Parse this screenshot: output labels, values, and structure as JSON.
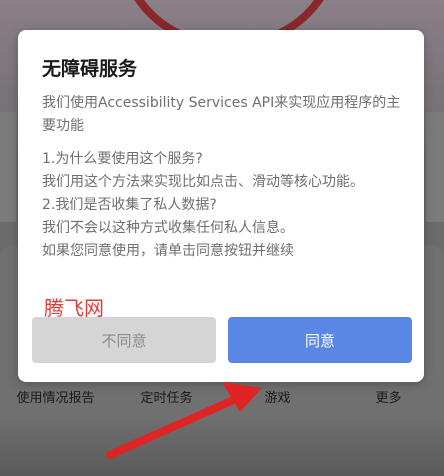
{
  "dialog": {
    "title": "无障碍服务",
    "intro": "我们使用Accessibility Services API来实现应用程序的主要功能",
    "q1": "1.为什么要使用这个服务?",
    "a1": "我们用这个方法来实现比如点击、滑动等核心功能。",
    "q2": "2.我们是否收集了私人数据?",
    "a2": "我们不会以这种方式收集任何私人信息。",
    "consent": "如果您同意使用，请单击同意按钮并继续",
    "decline_label": "不同意",
    "accept_label": "同意"
  },
  "watermark": "腾飞网",
  "nav": {
    "items": [
      "使用情况报告",
      "定时任务",
      "游戏",
      "更多"
    ]
  },
  "colors": {
    "accept": "#5a86e6",
    "decline": "#d5d5d5",
    "arrow": "#e02424"
  }
}
